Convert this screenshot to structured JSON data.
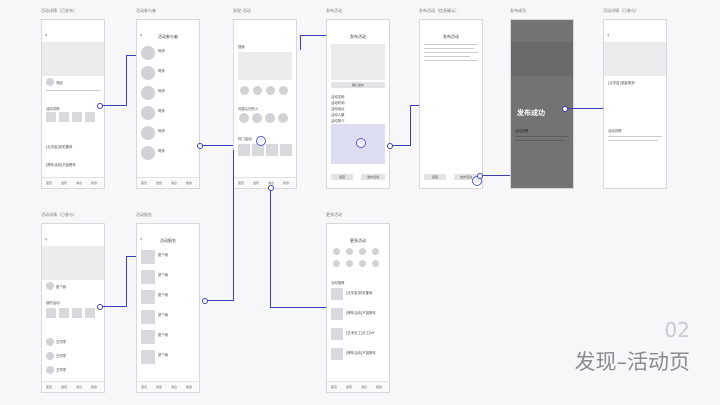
{
  "section": {
    "number": "02",
    "title": "发现–活动页"
  },
  "screens": {
    "s1": {
      "caption": "活动详情（已发布）",
      "name": "郑武",
      "tab_title": "活动详情",
      "title_label": "[元宇宙]",
      "title_text": "彩虹集体",
      "title2_label": "[跨年活动]",
      "title2_text": "不如跨年",
      "tabs": [
        "首页",
        "发现",
        "消息",
        "我的"
      ]
    },
    "s2": {
      "caption": "活动参与者",
      "title": "活动参与者",
      "row_name": "阿伊",
      "tabs": [
        "首页",
        "发现",
        "消息",
        "我的"
      ]
    },
    "s3": {
      "caption": "发现-活动",
      "search": "搜索",
      "popular": "热门活动",
      "nearby": "可能认识的人",
      "tabs": [
        "首页",
        "发现",
        "消息",
        "我的"
      ]
    },
    "s4": {
      "caption": "发布活动",
      "title": "发布活动",
      "confirm": "确认发布",
      "options": [
        "活动名称",
        "活动时间",
        "活动地点",
        "活动人数",
        "活动简介"
      ],
      "cancel": "返回",
      "publish": "发布活动"
    },
    "s5": {
      "caption": "发布活动（信息确认）",
      "title": "发布活动",
      "cancel": "返回",
      "publish": "发布活动"
    },
    "s6": {
      "caption": "发布成功",
      "success": "发布成功",
      "section": "活动详情"
    },
    "s7": {
      "caption": "活动详情（已参与）",
      "title_label": "[元宇宙]",
      "title_text": "流星观测",
      "section": "活动详情"
    },
    "s8": {
      "caption": "活动详情（已参与）",
      "name": "夏个我",
      "section": "我的活动",
      "row_name": "王同学",
      "tabs": [
        "首页",
        "发现",
        "消息",
        "我的"
      ]
    },
    "s9": {
      "caption": "活动报名",
      "title": "活动报名",
      "row_name": "夏个我",
      "tabs": [
        "首页",
        "发现",
        "消息",
        "我的"
      ]
    },
    "s10": {
      "caption": "更多活动",
      "title": "更多活动",
      "section": "为你推荐",
      "items": [
        {
          "label": "[元宇宙]",
          "text": "彩虹集体"
        },
        {
          "label": "[跨年活动]",
          "text": "不如跨年"
        },
        {
          "label": "[艺术手工]",
          "text": "手工DIY"
        },
        {
          "label": "[跨年活动]",
          "text": "不如跨年"
        }
      ],
      "tabs": [
        "首页",
        "发现",
        "消息",
        "我的"
      ]
    }
  },
  "colors": {
    "accent": "#3d3db8",
    "placeholder": "#d9d9dd"
  }
}
